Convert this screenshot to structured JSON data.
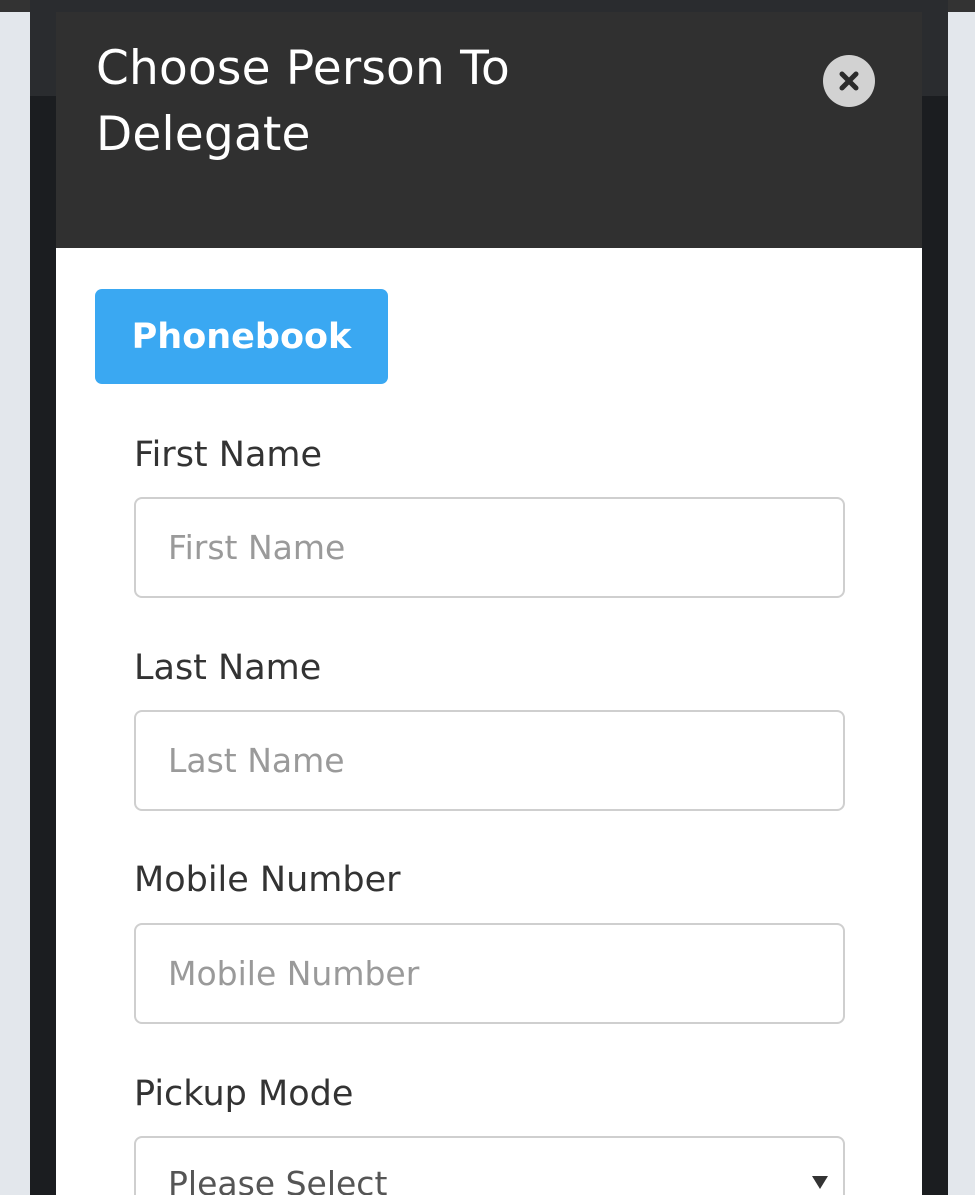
{
  "dialog": {
    "title": "Choose Person To Delegate",
    "close_icon": "close-icon"
  },
  "phonebook_button": {
    "label": "Phonebook"
  },
  "form": {
    "first_name": {
      "label": "First Name",
      "placeholder": "First Name",
      "value": ""
    },
    "last_name": {
      "label": "Last Name",
      "placeholder": "Last Name",
      "value": ""
    },
    "mobile_number": {
      "label": "Mobile Number",
      "placeholder": "Mobile Number",
      "value": ""
    },
    "pickup_mode": {
      "label": "Pickup Mode",
      "selected": "Please Select",
      "arrow_icon": "caret-down-icon"
    }
  },
  "colors": {
    "header_bg": "#303030",
    "accent": "#3aa8f2",
    "page_bg": "#e3e7ec"
  }
}
